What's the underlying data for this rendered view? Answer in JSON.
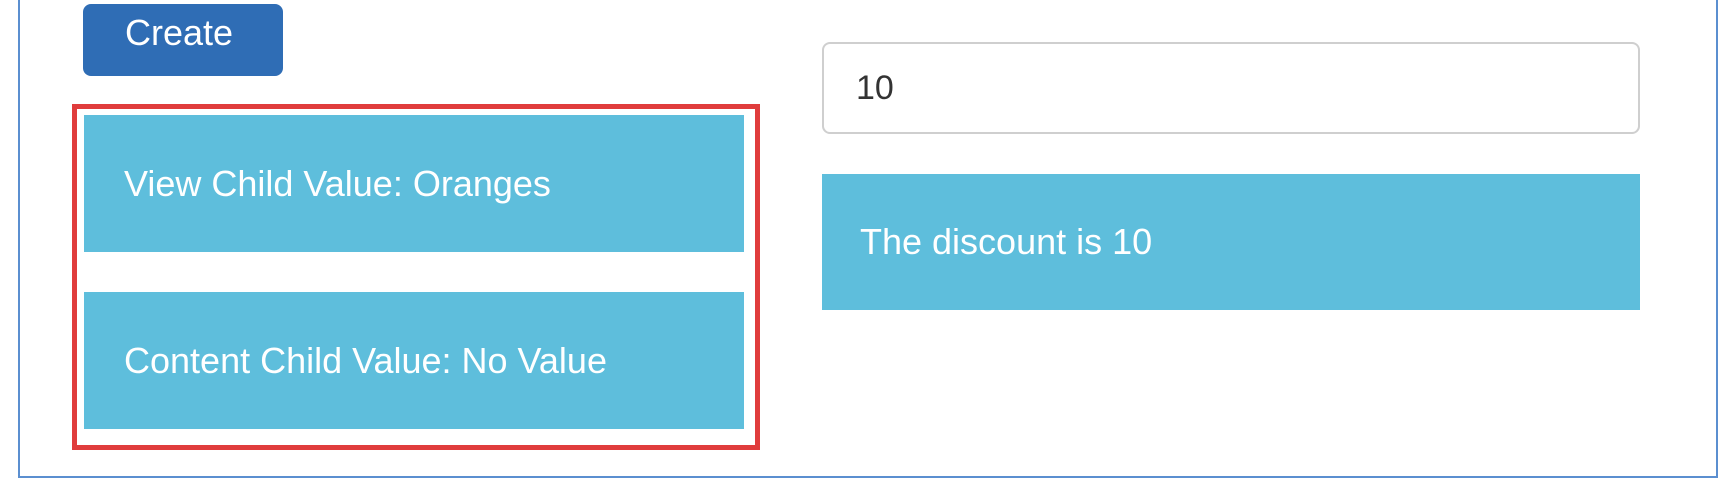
{
  "toolbar": {
    "create_label": "Create"
  },
  "children": {
    "view_child_text": "View Child Value: Oranges",
    "content_child_text": "Content Child Value: No Value"
  },
  "discount": {
    "input_value": "10",
    "message": "The discount is 10"
  },
  "colors": {
    "primary_button": "#2f6db5",
    "panel": "#5ebedc",
    "highlight_border": "#e03c3c",
    "frame_border": "#5b8fd0"
  }
}
